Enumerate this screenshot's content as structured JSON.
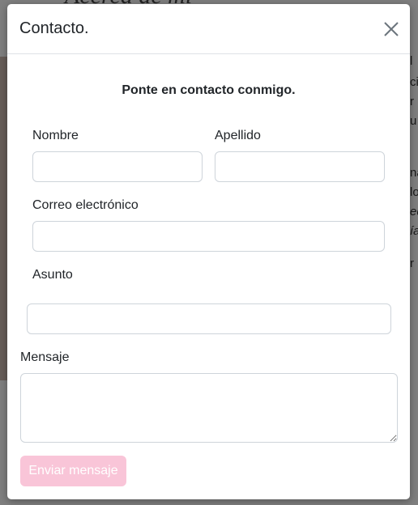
{
  "modal": {
    "title": "Contacto.",
    "intro": "Ponte en contacto conmigo.",
    "fields": {
      "nombre": {
        "label": "Nombre",
        "value": ""
      },
      "apellido": {
        "label": "Apellido",
        "value": ""
      },
      "correo": {
        "label": "Correo electrónico",
        "value": ""
      },
      "asunto": {
        "label": "Asunto",
        "value": ""
      },
      "mensaje": {
        "label": "Mensaje",
        "value": ""
      }
    },
    "submit_label": "Enviar mensaje",
    "submit_color": "#f9c5d8"
  },
  "background": {
    "heading_fragment": "Acerca de mí",
    "text_fragments": [
      "l",
      "ci",
      "r",
      "u",
      "na",
      "lo",
      "ed",
      "ía",
      "r"
    ]
  },
  "icons": {
    "close": "close-icon"
  }
}
